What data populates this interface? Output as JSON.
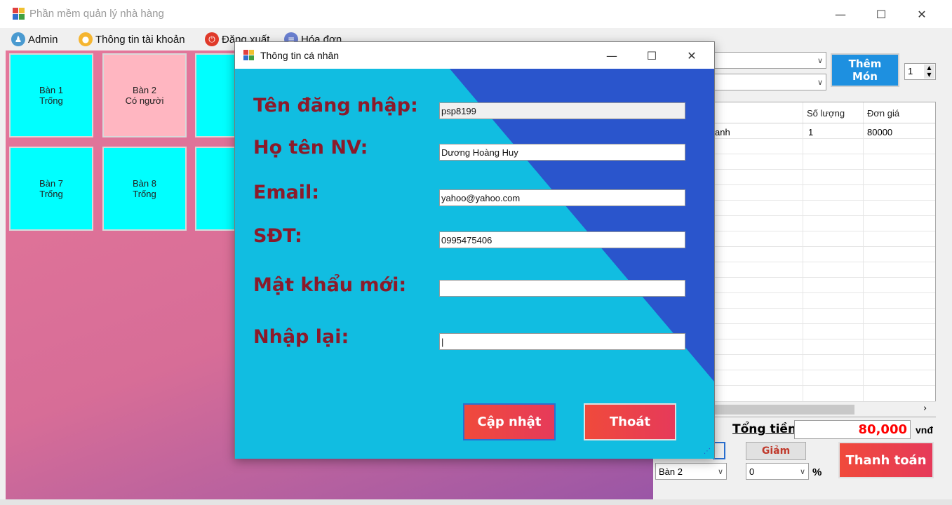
{
  "main": {
    "title": "Phần mềm quản lý nhà hàng",
    "menu": [
      {
        "label": "Admin",
        "icon": "admin-icon"
      },
      {
        "label": "Thông tin tài khoản",
        "icon": "account-icon"
      },
      {
        "label": "Đăng xuất",
        "icon": "power-icon"
      },
      {
        "label": "Hóa đơn",
        "icon": "invoice-icon"
      }
    ],
    "tables": [
      {
        "name": "Bàn 1",
        "status": "Trống"
      },
      {
        "name": "Bàn 2",
        "status": "Có người"
      },
      {
        "name": "Bà",
        "status": "Tr"
      },
      {
        "name": "Bàn 7",
        "status": "Trống"
      },
      {
        "name": "Bàn 8",
        "status": "Trống"
      },
      {
        "name": "Bà",
        "status": "Tr"
      }
    ],
    "add_food_label": "Thêm Món",
    "quantity_value": "1",
    "grid": {
      "headers": [
        "Số lượng",
        "Đơn giá"
      ],
      "rows": [
        {
          "name": "anh",
          "qty": "1",
          "price": "80000"
        }
      ]
    },
    "total_label": "Tổng tiền:",
    "total_value": "80,000",
    "currency": "vnđ",
    "discount_button": "Giảm",
    "switch_table_value": "Bàn 2",
    "discount_value": "0",
    "percent_label": "%",
    "checkout_button": "Thanh toán"
  },
  "dialog": {
    "title": "Thông tin cá nhân",
    "labels": {
      "username": "Tên đăng nhập:",
      "fullname": "Họ tên NV:",
      "email": "Email:",
      "phone": "SĐT:",
      "new_password": "Mật khẩu mới:",
      "confirm": "Nhập lại:"
    },
    "values": {
      "username": "psp8199",
      "fullname": "Dương Hoàng Huy",
      "email": "yahoo@yahoo.com",
      "phone": "0995475406",
      "new_password": "",
      "confirm": "|"
    },
    "update_button": "Cập nhật",
    "exit_button": "Thoát"
  },
  "colors": {
    "table_empty": "#00ffff",
    "table_busy": "#ffb6c1",
    "label_red": "#8b1a2a",
    "dialog_bg": "#11bde1",
    "dialog_accent": "#2a55cc",
    "total_red": "#ff0000"
  }
}
